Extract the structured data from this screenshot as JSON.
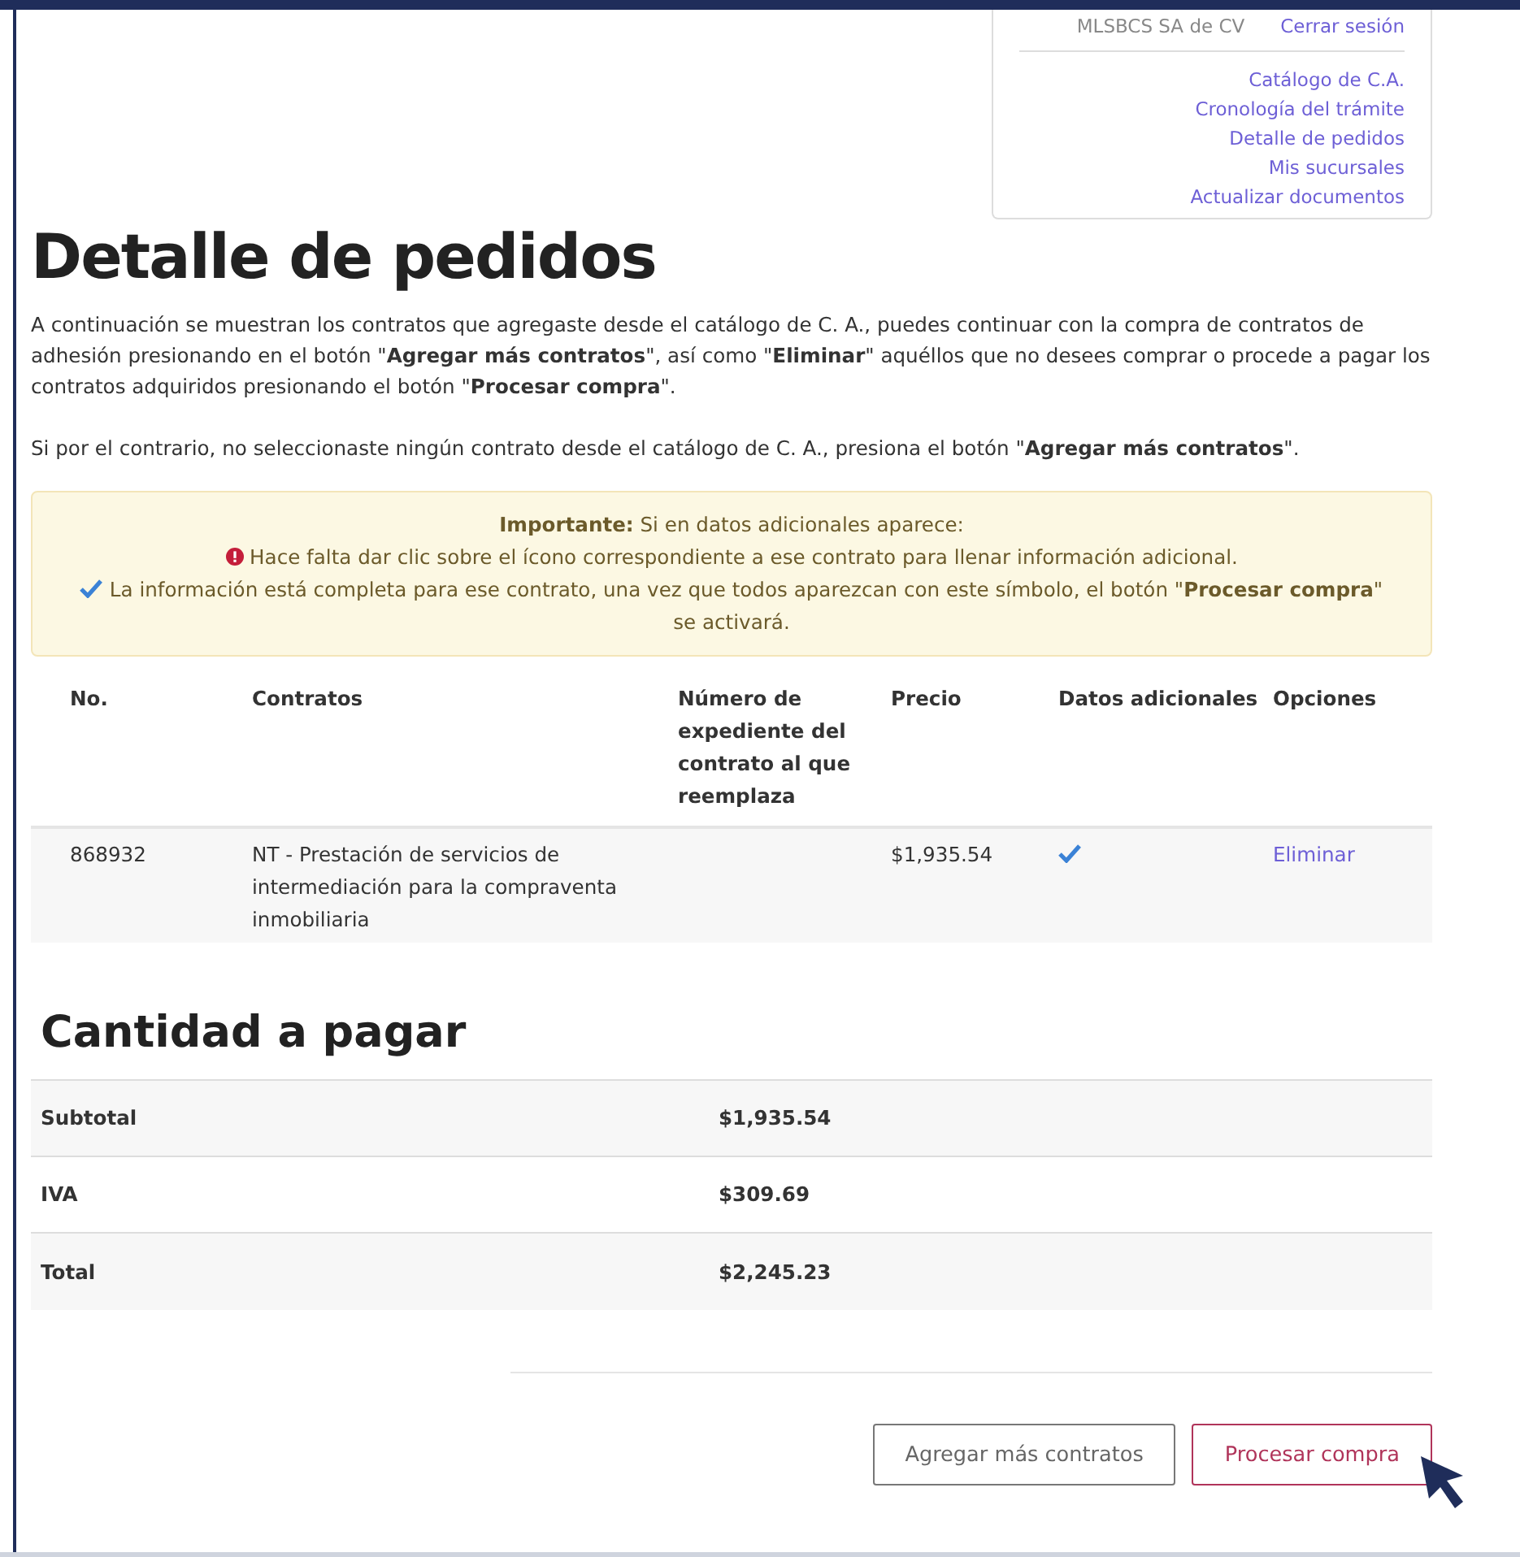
{
  "account": {
    "user": "MLSBCS SA de CV",
    "logout": "Cerrar sesión"
  },
  "nav": [
    {
      "label": "Catálogo de C.A.",
      "selected": false
    },
    {
      "label": "Cronología del trámite",
      "selected": false
    },
    {
      "label": "Detalle de pedidos",
      "selected": false
    },
    {
      "label": "Mis sucursales",
      "selected": false
    },
    {
      "label": "Actualizar documentos",
      "selected": false
    }
  ],
  "title": "Detalle de pedidos",
  "intro": [
    "A continuación se muestran los contratos que agregaste desde el catálogo de C. A., puedes continuar con la compra de contratos de adhesión presionando en el botón \"**Agregar más contratos**\", así como \"**Eliminar**\" aquéllos que no desees comprar o procede a pagar los contratos adquiridos presionando el botón \"**Procesar compra**\".",
    "Si por el contrario, no seleccionaste ningún contrato desde el catálogo de C. A., presiona el botón \"**Agregar más contratos**\"."
  ],
  "notice": {
    "heading": "**Importante:** Si en datos adicionales aparece:",
    "items": [
      {
        "kind": "error",
        "text": "Hace falta dar clic sobre el ícono correspondiente a ese contrato para llenar información adicional."
      },
      {
        "kind": "check",
        "text": "La información está completa para ese contrato, una vez que todos aparezcan con este símbolo, el botón \"**Procesar compra**\" se activará."
      }
    ]
  },
  "table": {
    "columns": [
      "No.",
      "Contratos",
      "Número de expediente del contrato al que reemplaza",
      "Precio",
      "Datos adicionales",
      "Opciones"
    ],
    "rows": [
      {
        "no": "868932",
        "contract": "NT - Prestación de servicios de intermediación para la compraventa inmobiliaria",
        "price": "$1,935.54",
        "complete": true,
        "action": "Eliminar"
      }
    ]
  },
  "totals": {
    "heading": "Cantidad a pagar",
    "rows": [
      {
        "label": "Subtotal",
        "value": "$1,935.54"
      },
      {
        "label": "IVA",
        "value": "$309.69"
      },
      {
        "label": "Total",
        "value": "$2,245.23"
      }
    ]
  },
  "buttons": [
    {
      "label": "Agregar más contratos",
      "kind": "secondary"
    },
    {
      "label": "Procesar compra",
      "kind": "primary"
    }
  ]
}
